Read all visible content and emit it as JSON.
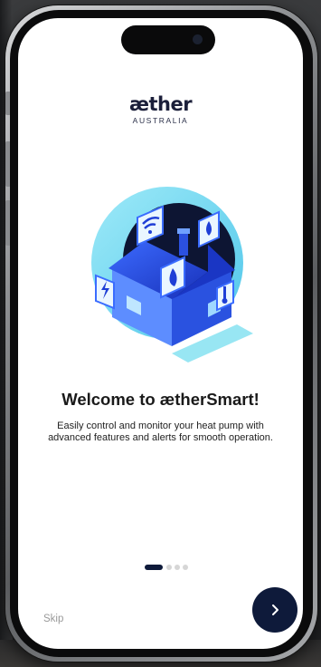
{
  "logo": {
    "brand": "æther",
    "sub": "AUSTRALIA"
  },
  "onboarding": {
    "title": "Welcome to ætherSmart!",
    "description": "Easily control and monitor your heat pump with advanced features and  alerts for smooth operation.",
    "pages": 4,
    "current_page": 1
  },
  "actions": {
    "skip_label": "Skip",
    "next_icon": "chevron-right-icon"
  },
  "colors": {
    "accent_dark": "#0e1a3a",
    "illustration_blue": "#2f6bff",
    "circle_cyan": "#6fd8f0"
  },
  "icons": [
    "wifi-icon",
    "water-drop-icon",
    "flame-icon",
    "lightning-icon",
    "thermometer-icon"
  ]
}
